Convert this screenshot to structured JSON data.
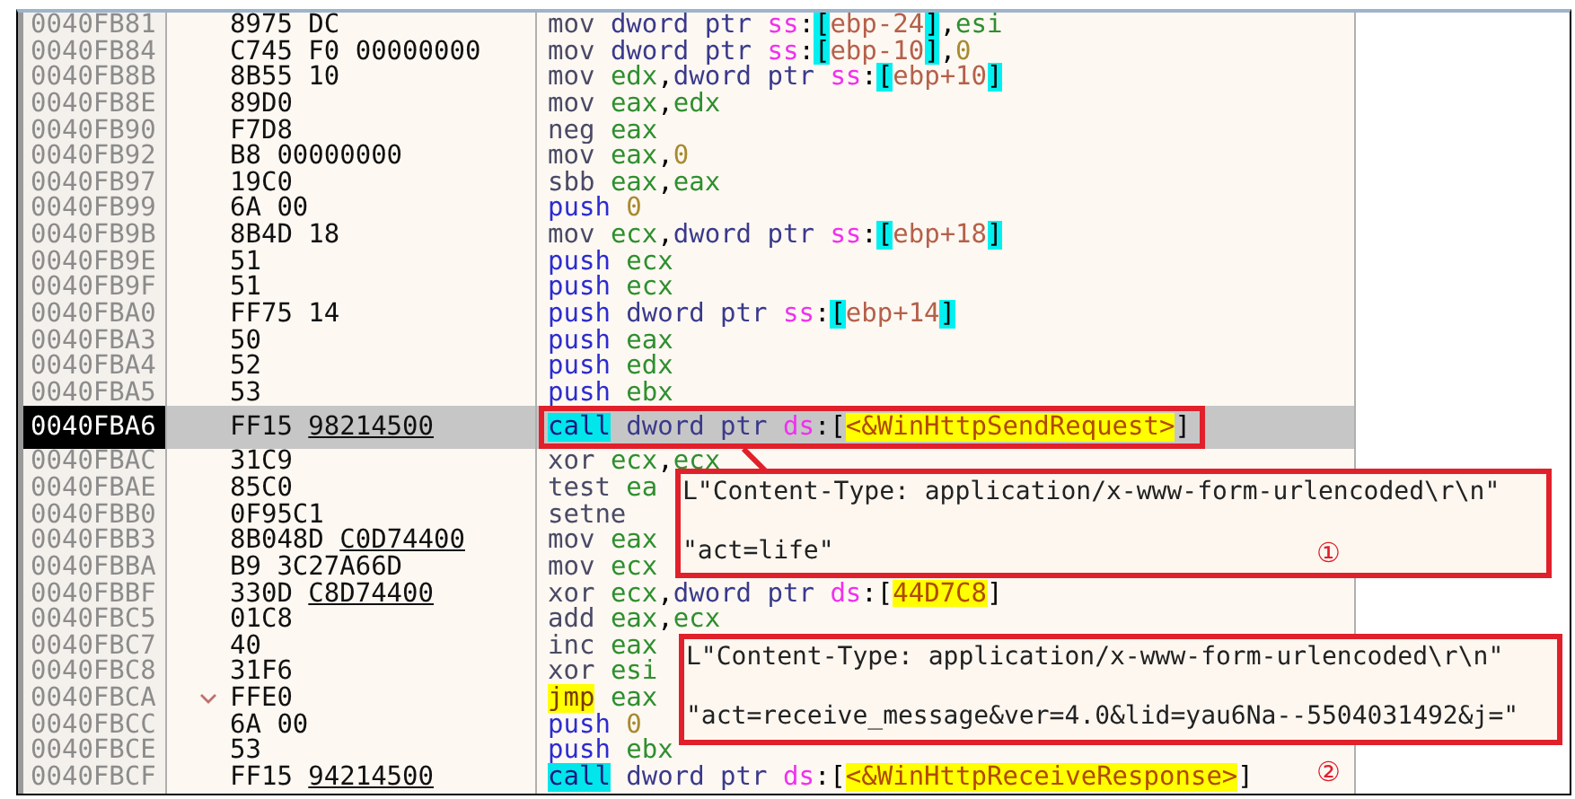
{
  "rows": [
    {
      "address": "0040FB81",
      "bytes": "8975 DC",
      "jump": false,
      "selected": false,
      "boxed": false,
      "tokens": [
        {
          "text": "mov",
          "kind": "op"
        },
        {
          "text": "dword ptr",
          "kind": "size"
        },
        {
          "text": "ss",
          "kind": "seg"
        },
        {
          "text": ":",
          "kind": "p"
        },
        {
          "text": "[",
          "kind": "br"
        },
        {
          "text": "ebp-24",
          "kind": "mem"
        },
        {
          "text": "]",
          "kind": "br"
        },
        {
          "text": ",",
          "kind": "p"
        },
        {
          "text": "esi",
          "kind": "reg"
        }
      ]
    },
    {
      "address": "0040FB84",
      "bytes": "C745 F0 00000000",
      "jump": false,
      "selected": false,
      "boxed": false,
      "tokens": [
        {
          "text": "mov",
          "kind": "op"
        },
        {
          "text": "dword ptr",
          "kind": "size"
        },
        {
          "text": "ss",
          "kind": "seg"
        },
        {
          "text": ":",
          "kind": "p"
        },
        {
          "text": "[",
          "kind": "br"
        },
        {
          "text": "ebp-10",
          "kind": "mem"
        },
        {
          "text": "]",
          "kind": "br"
        },
        {
          "text": ",",
          "kind": "p"
        },
        {
          "text": "0",
          "kind": "num"
        }
      ]
    },
    {
      "address": "0040FB8B",
      "bytes": "8B55 10",
      "jump": false,
      "selected": false,
      "boxed": false,
      "tokens": [
        {
          "text": "mov",
          "kind": "op"
        },
        {
          "text": "edx",
          "kind": "reg"
        },
        {
          "text": ",",
          "kind": "p"
        },
        {
          "text": "dword ptr",
          "kind": "size"
        },
        {
          "text": "ss",
          "kind": "seg"
        },
        {
          "text": ":",
          "kind": "p"
        },
        {
          "text": "[",
          "kind": "br"
        },
        {
          "text": "ebp+10",
          "kind": "mem"
        },
        {
          "text": "]",
          "kind": "br"
        }
      ]
    },
    {
      "address": "0040FB8E",
      "bytes": "89D0",
      "jump": false,
      "selected": false,
      "boxed": false,
      "tokens": [
        {
          "text": "mov",
          "kind": "op"
        },
        {
          "text": "eax",
          "kind": "reg"
        },
        {
          "text": ",",
          "kind": "p"
        },
        {
          "text": "edx",
          "kind": "reg"
        }
      ]
    },
    {
      "address": "0040FB90",
      "bytes": "F7D8",
      "jump": false,
      "selected": false,
      "boxed": false,
      "tokens": [
        {
          "text": "neg",
          "kind": "op"
        },
        {
          "text": "eax",
          "kind": "reg"
        }
      ]
    },
    {
      "address": "0040FB92",
      "bytes": "B8 00000000",
      "jump": false,
      "selected": false,
      "boxed": false,
      "tokens": [
        {
          "text": "mov",
          "kind": "op"
        },
        {
          "text": "eax",
          "kind": "reg"
        },
        {
          "text": ",",
          "kind": "p"
        },
        {
          "text": "0",
          "kind": "num"
        }
      ]
    },
    {
      "address": "0040FB97",
      "bytes": "19C0",
      "jump": false,
      "selected": false,
      "boxed": false,
      "tokens": [
        {
          "text": "sbb",
          "kind": "op"
        },
        {
          "text": "eax",
          "kind": "reg"
        },
        {
          "text": ",",
          "kind": "p"
        },
        {
          "text": "eax",
          "kind": "reg"
        }
      ]
    },
    {
      "address": "0040FB99",
      "bytes": "6A 00",
      "jump": false,
      "selected": false,
      "boxed": false,
      "tokens": [
        {
          "text": "push",
          "kind": "push"
        },
        {
          "text": "0",
          "kind": "num"
        }
      ]
    },
    {
      "address": "0040FB9B",
      "bytes": "8B4D 18",
      "jump": false,
      "selected": false,
      "boxed": false,
      "tokens": [
        {
          "text": "mov",
          "kind": "op"
        },
        {
          "text": "ecx",
          "kind": "reg"
        },
        {
          "text": ",",
          "kind": "p"
        },
        {
          "text": "dword ptr",
          "kind": "size"
        },
        {
          "text": "ss",
          "kind": "seg"
        },
        {
          "text": ":",
          "kind": "p"
        },
        {
          "text": "[",
          "kind": "br"
        },
        {
          "text": "ebp+18",
          "kind": "mem"
        },
        {
          "text": "]",
          "kind": "br"
        }
      ]
    },
    {
      "address": "0040FB9E",
      "bytes": "51",
      "jump": false,
      "selected": false,
      "boxed": false,
      "tokens": [
        {
          "text": "push",
          "kind": "push"
        },
        {
          "text": "ecx",
          "kind": "reg"
        }
      ]
    },
    {
      "address": "0040FB9F",
      "bytes": "51",
      "jump": false,
      "selected": false,
      "boxed": false,
      "tokens": [
        {
          "text": "push",
          "kind": "push"
        },
        {
          "text": "ecx",
          "kind": "reg"
        }
      ]
    },
    {
      "address": "0040FBA0",
      "bytes": "FF75 14",
      "jump": false,
      "selected": false,
      "boxed": false,
      "tokens": [
        {
          "text": "push",
          "kind": "push"
        },
        {
          "text": "dword ptr",
          "kind": "size"
        },
        {
          "text": "ss",
          "kind": "seg"
        },
        {
          "text": ":",
          "kind": "p"
        },
        {
          "text": "[",
          "kind": "br"
        },
        {
          "text": "ebp+14",
          "kind": "mem"
        },
        {
          "text": "]",
          "kind": "br"
        }
      ]
    },
    {
      "address": "0040FBA3",
      "bytes": "50",
      "jump": false,
      "selected": false,
      "boxed": false,
      "tokens": [
        {
          "text": "push",
          "kind": "push"
        },
        {
          "text": "eax",
          "kind": "reg"
        }
      ]
    },
    {
      "address": "0040FBA4",
      "bytes": "52",
      "jump": false,
      "selected": false,
      "boxed": false,
      "tokens": [
        {
          "text": "push",
          "kind": "push"
        },
        {
          "text": "edx",
          "kind": "reg"
        }
      ]
    },
    {
      "address": "0040FBA5",
      "bytes": "53",
      "jump": false,
      "selected": false,
      "boxed": false,
      "tokens": [
        {
          "text": "push",
          "kind": "push"
        },
        {
          "text": "ebx",
          "kind": "reg"
        }
      ]
    },
    {
      "address": "0040FBA6",
      "bytes": "FF15",
      "ref": "98214500",
      "jump": false,
      "selected": true,
      "boxed": true,
      "tokens": [
        {
          "text": "call",
          "kind": "call"
        },
        {
          "text": "dword ptr",
          "kind": "size"
        },
        {
          "text": "ds",
          "kind": "seg"
        },
        {
          "text": ":",
          "kind": "p"
        },
        {
          "text": "[",
          "kind": "p"
        },
        {
          "text": "<&WinHttpSendRequest>",
          "kind": "sym"
        },
        {
          "text": "]",
          "kind": "p"
        }
      ]
    },
    {
      "address": "0040FBAC",
      "bytes": "31C9",
      "jump": false,
      "selected": false,
      "boxed": false,
      "tokens": [
        {
          "text": "xor",
          "kind": "op"
        },
        {
          "text": "ecx",
          "kind": "reg"
        },
        {
          "text": ",",
          "kind": "p"
        },
        {
          "text": "ecx",
          "kind": "reg"
        }
      ]
    },
    {
      "address": "0040FBAE",
      "bytes": "85C0",
      "jump": false,
      "selected": false,
      "boxed": false,
      "tokens": [
        {
          "text": "test",
          "kind": "op"
        },
        {
          "text": "ea",
          "kind": "reg"
        }
      ]
    },
    {
      "address": "0040FBB0",
      "bytes": "0F95C1",
      "jump": false,
      "selected": false,
      "boxed": false,
      "tokens": [
        {
          "text": "setne",
          "kind": "op"
        }
      ]
    },
    {
      "address": "0040FBB3",
      "bytes": "8B048D",
      "ref": "C0D74400",
      "jump": false,
      "selected": false,
      "boxed": false,
      "tokens": [
        {
          "text": "mov",
          "kind": "op"
        },
        {
          "text": "eax",
          "kind": "reg"
        }
      ]
    },
    {
      "address": "0040FBBA",
      "bytes": "B9 3C27A66D",
      "jump": false,
      "selected": false,
      "boxed": false,
      "tokens": [
        {
          "text": "mov",
          "kind": "op"
        },
        {
          "text": "ecx",
          "kind": "reg"
        }
      ]
    },
    {
      "address": "0040FBBF",
      "bytes": "330D",
      "ref": "C8D74400",
      "jump": false,
      "selected": false,
      "boxed": false,
      "tokens": [
        {
          "text": "xor",
          "kind": "op"
        },
        {
          "text": "ecx",
          "kind": "reg"
        },
        {
          "text": ",",
          "kind": "p"
        },
        {
          "text": "dword ptr",
          "kind": "size"
        },
        {
          "text": "ds",
          "kind": "seg"
        },
        {
          "text": ":",
          "kind": "p"
        },
        {
          "text": "[",
          "kind": "p"
        },
        {
          "text": "44D7C8",
          "kind": "sym"
        },
        {
          "text": "]",
          "kind": "p"
        }
      ]
    },
    {
      "address": "0040FBC5",
      "bytes": "01C8",
      "jump": false,
      "selected": false,
      "boxed": false,
      "tokens": [
        {
          "text": "add",
          "kind": "op"
        },
        {
          "text": "eax",
          "kind": "reg"
        },
        {
          "text": ",",
          "kind": "p"
        },
        {
          "text": "ecx",
          "kind": "reg"
        }
      ]
    },
    {
      "address": "0040FBC7",
      "bytes": "40",
      "jump": false,
      "selected": false,
      "boxed": false,
      "tokens": [
        {
          "text": "inc",
          "kind": "op"
        },
        {
          "text": "eax",
          "kind": "reg"
        }
      ]
    },
    {
      "address": "0040FBC8",
      "bytes": "31F6",
      "jump": false,
      "selected": false,
      "boxed": false,
      "tokens": [
        {
          "text": "xor",
          "kind": "op"
        },
        {
          "text": "esi",
          "kind": "reg"
        }
      ]
    },
    {
      "address": "0040FBCA",
      "bytes": "FFE0",
      "jump": true,
      "selected": false,
      "boxed": false,
      "tokens": [
        {
          "text": "jmp",
          "kind": "jmp"
        },
        {
          "text": "eax",
          "kind": "reg"
        }
      ]
    },
    {
      "address": "0040FBCC",
      "bytes": "6A 00",
      "jump": false,
      "selected": false,
      "boxed": false,
      "tokens": [
        {
          "text": "push",
          "kind": "push"
        },
        {
          "text": "0",
          "kind": "num"
        }
      ]
    },
    {
      "address": "0040FBCE",
      "bytes": "53",
      "jump": false,
      "selected": false,
      "boxed": false,
      "tokens": [
        {
          "text": "push",
          "kind": "push"
        },
        {
          "text": "ebx",
          "kind": "reg"
        }
      ]
    },
    {
      "address": "0040FBCF",
      "bytes": "FF15",
      "ref": "94214500",
      "jump": false,
      "selected": false,
      "boxed": false,
      "tokens": [
        {
          "text": "call",
          "kind": "call"
        },
        {
          "text": "dword ptr",
          "kind": "size"
        },
        {
          "text": "ds",
          "kind": "seg"
        },
        {
          "text": ":",
          "kind": "p"
        },
        {
          "text": "[",
          "kind": "p"
        },
        {
          "text": "<&WinHttpReceiveResponse>",
          "kind": "sym"
        },
        {
          "text": "]",
          "kind": "p"
        }
      ]
    }
  ],
  "callouts": [
    {
      "lines": [
        "L\"Content-Type: application/x-www-form-urlencoded\\r\\n\"",
        "\"act=life\""
      ],
      "number": "①",
      "linked": true
    },
    {
      "lines": [
        "L\"Content-Type: application/x-www-form-urlencoded\\r\\n\"",
        "\"act=receive_message&ver=4.0&lid=yau6Na--5504031492&j=\""
      ],
      "number": "②",
      "linked": false
    }
  ]
}
